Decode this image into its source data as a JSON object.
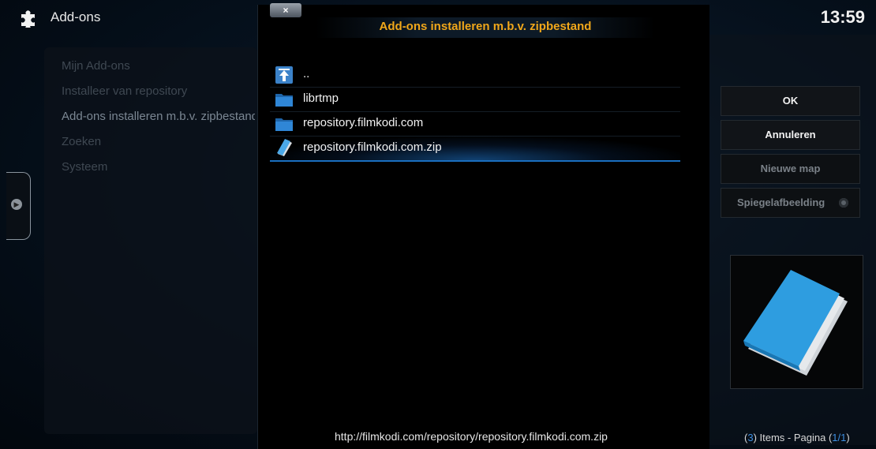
{
  "header": {
    "app_title": "Add-ons",
    "clock": "13:59"
  },
  "menu": {
    "items": [
      {
        "label": "Mijn Add-ons"
      },
      {
        "label": "Installeer van repository"
      },
      {
        "label": "Add-ons installeren m.b.v. zipbestand"
      },
      {
        "label": "Zoeken"
      },
      {
        "label": "Systeem"
      }
    ]
  },
  "dialog": {
    "close_label": "×",
    "title": "Add-ons installeren m.b.v. zipbestand",
    "files": [
      {
        "label": "..",
        "icon": "parent-folder-icon"
      },
      {
        "label": "librtmp",
        "icon": "folder-icon"
      },
      {
        "label": "repository.filmkodi.com",
        "icon": "folder-icon"
      },
      {
        "label": "repository.filmkodi.com.zip",
        "icon": "zip-file-icon"
      }
    ],
    "selected_index": 3,
    "path": "http://filmkodi.com/repository/repository.filmkodi.com.zip"
  },
  "buttons": {
    "ok": "OK",
    "cancel": "Annuleren",
    "new_folder": "Nieuwe map",
    "mirror": "Spiegelafbeelding"
  },
  "status": {
    "count": "3",
    "items_label": ") Items - Pagina (",
    "page": "1/1",
    "open_paren": "(",
    "close_paren": ")"
  },
  "colors": {
    "title_accent": "#f0a71a",
    "selection_accent": "#1a6fc0",
    "count_accent": "#3d8ee0"
  }
}
